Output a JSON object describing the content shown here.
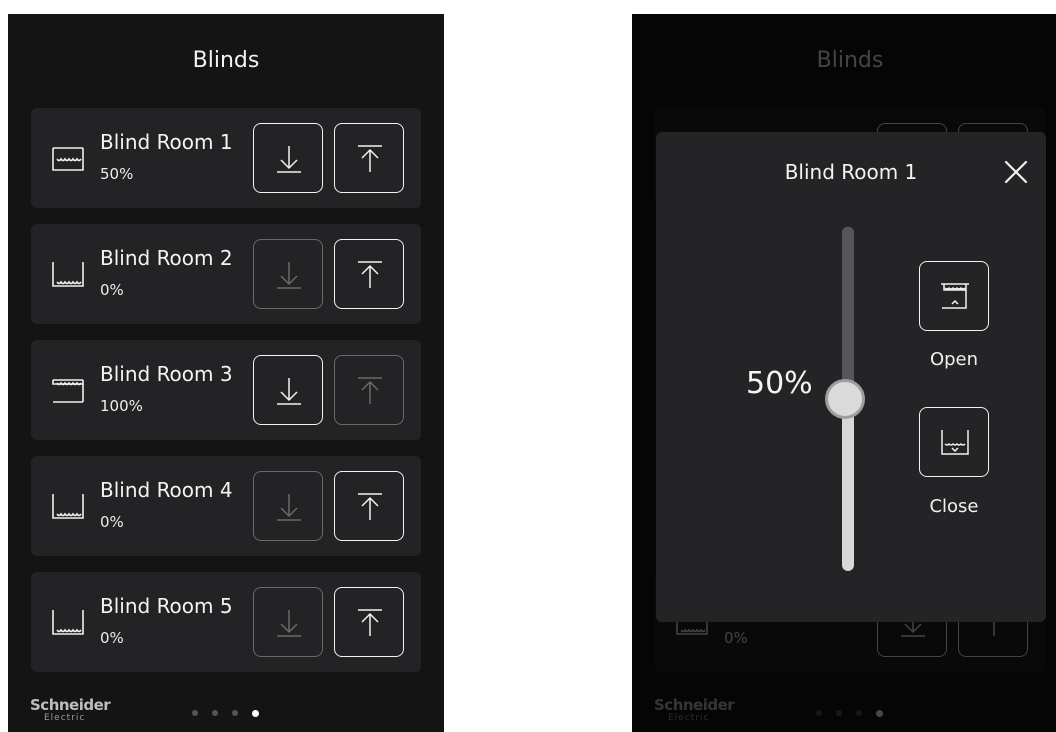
{
  "blinds_screen": {
    "title": "Blinds",
    "items": [
      {
        "name": "Blind Room 1",
        "value": "50%",
        "icon": "blind-half-icon",
        "down_enabled": true,
        "up_enabled": true
      },
      {
        "name": "Blind Room 2",
        "value": "0%",
        "icon": "blind-open-icon",
        "down_enabled": false,
        "up_enabled": true
      },
      {
        "name": "Blind Room 3",
        "value": "100%",
        "icon": "blind-closed-icon",
        "down_enabled": true,
        "up_enabled": false
      },
      {
        "name": "Blind Room 4",
        "value": "0%",
        "icon": "blind-open-icon",
        "down_enabled": false,
        "up_enabled": true
      },
      {
        "name": "Blind Room 5",
        "value": "0%",
        "icon": "blind-open-icon",
        "down_enabled": false,
        "up_enabled": true
      }
    ],
    "background_item": {
      "value": "0%"
    }
  },
  "footer": {
    "brand": "Schneider",
    "brand_sub": "Electric",
    "page_count": 4,
    "active_page": 4
  },
  "modal": {
    "title": "Blind Room 1",
    "slider_value": 50,
    "slider_label": "50%",
    "open_label": "Open",
    "close_label": "Close"
  },
  "colors": {
    "screen_bg": "#141414",
    "card_bg": "#232325",
    "text": "#f4f4f4",
    "disabled_border": "#6a6a6a"
  }
}
